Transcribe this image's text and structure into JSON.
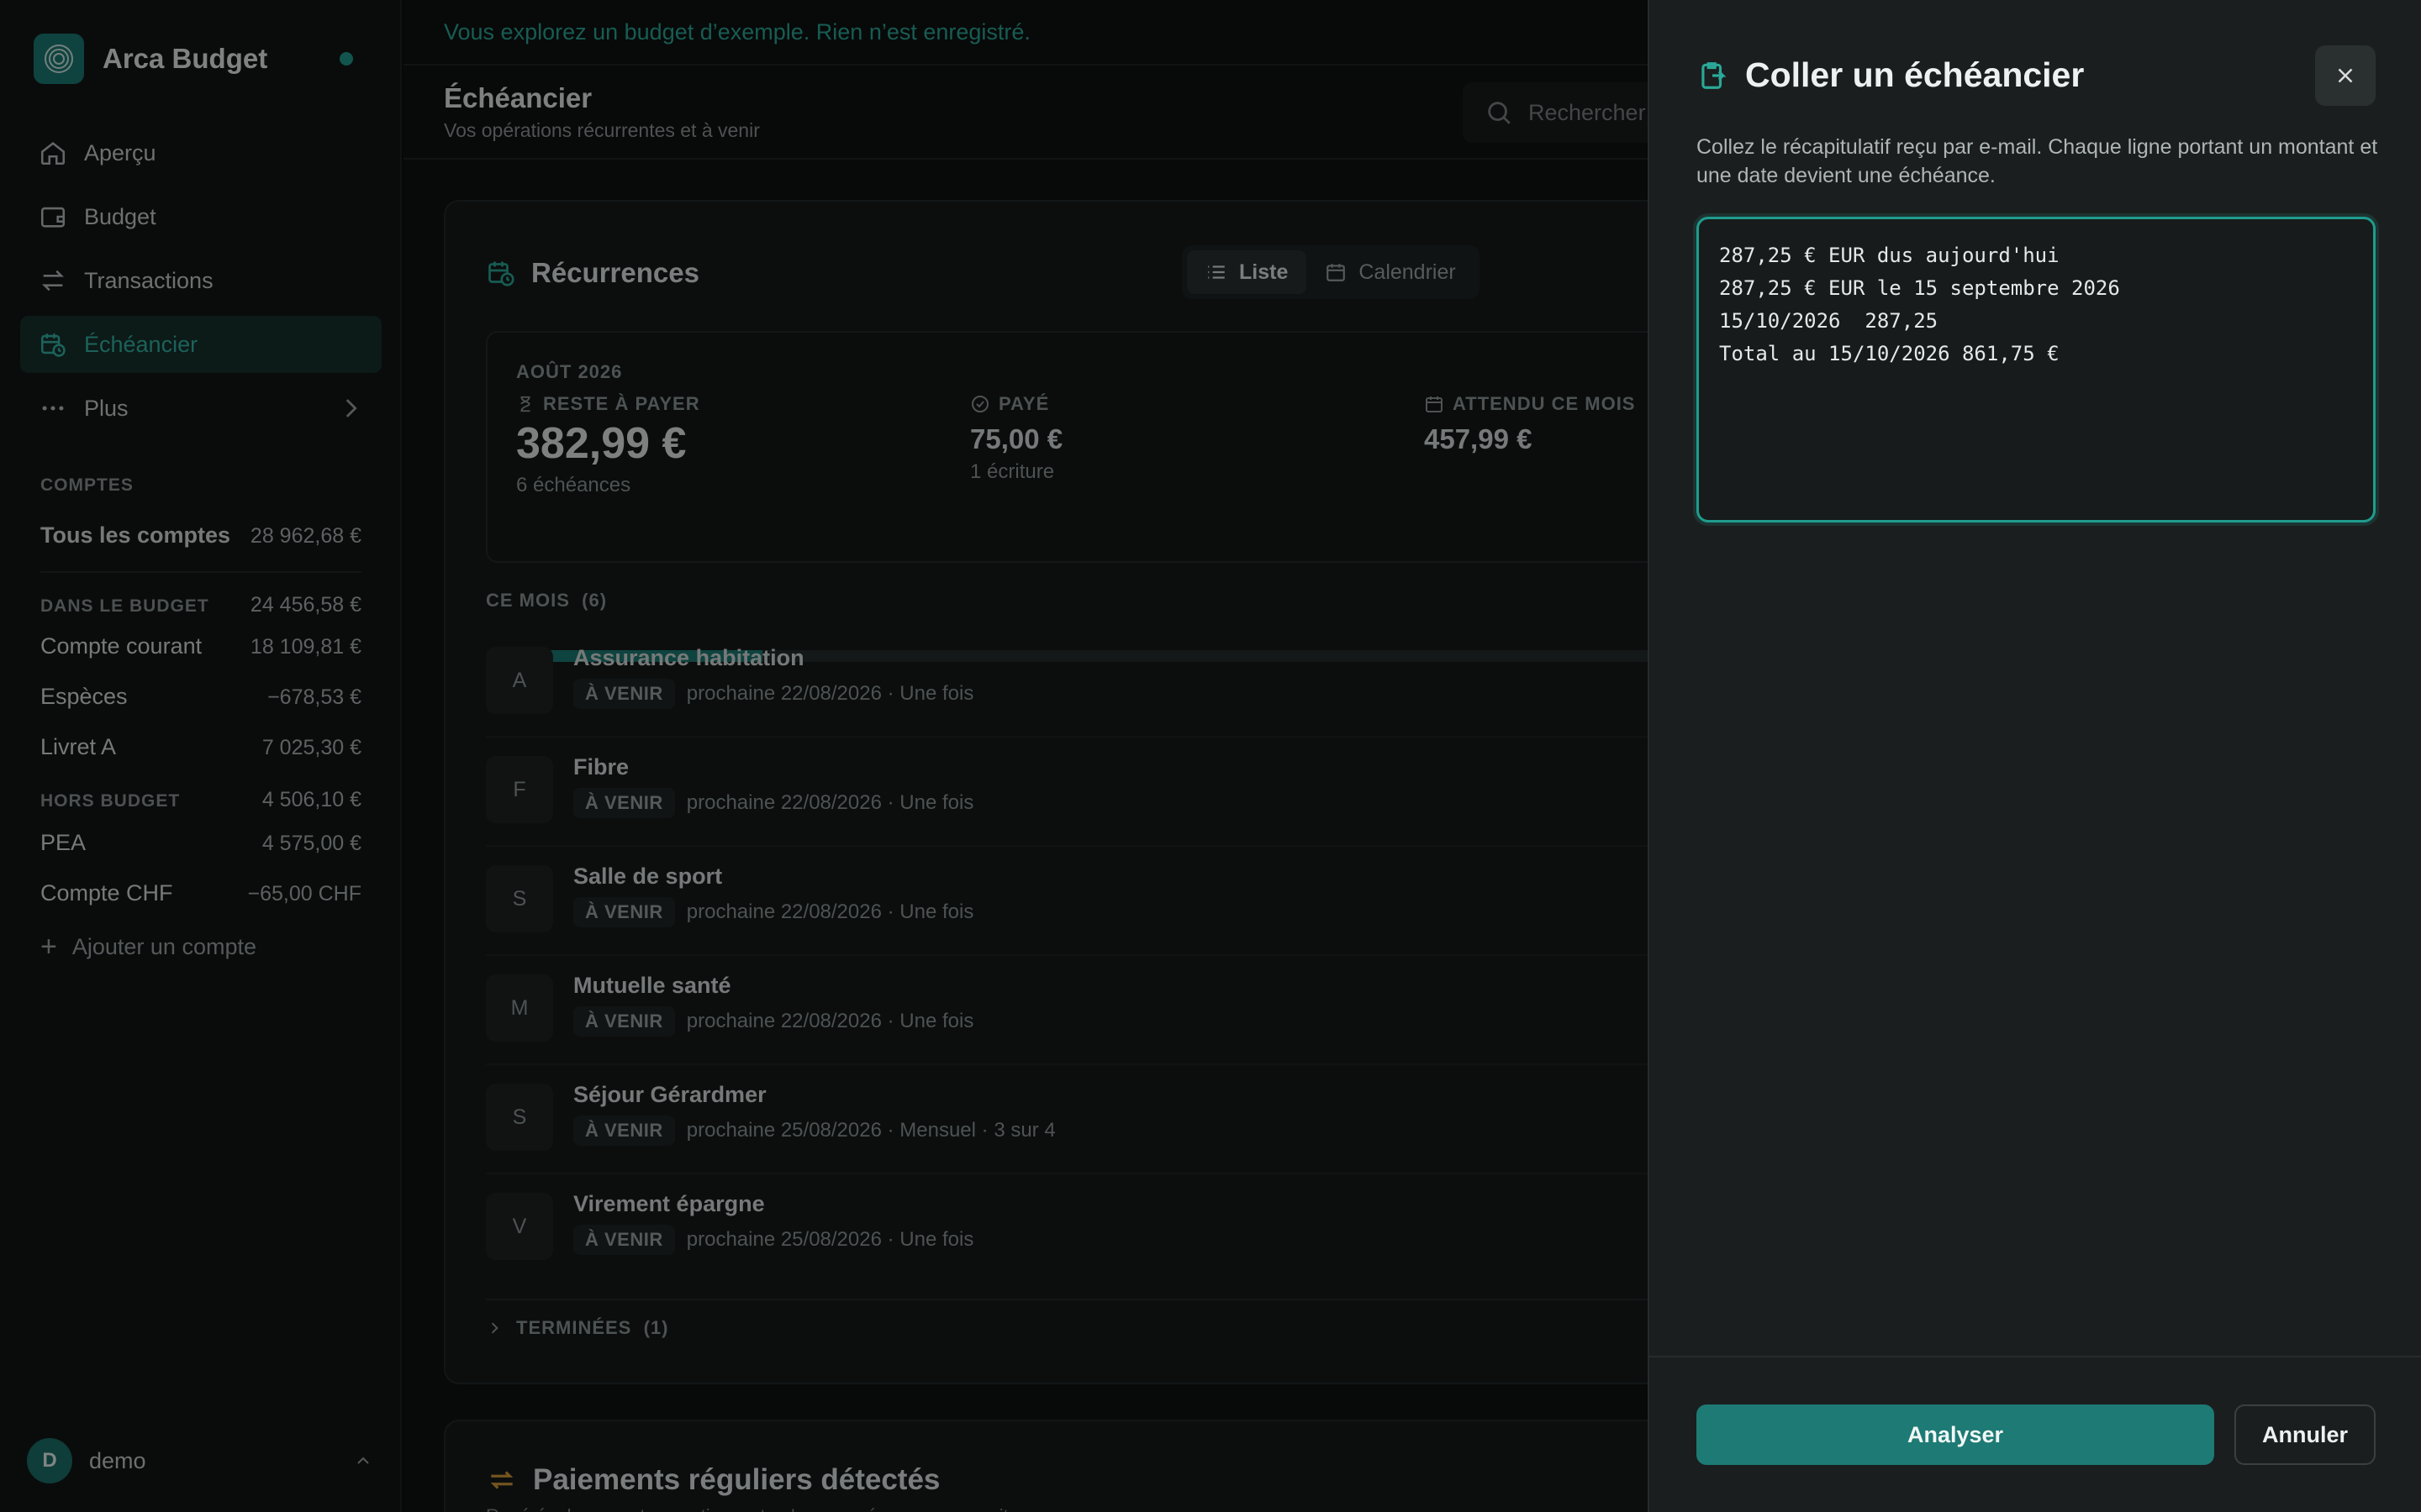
{
  "app": {
    "name": "Arca Budget"
  },
  "sidebar": {
    "nav": [
      {
        "label": "Aperçu",
        "icon": "home-icon"
      },
      {
        "label": "Budget",
        "icon": "wallet-icon"
      },
      {
        "label": "Transactions",
        "icon": "swap-icon"
      },
      {
        "label": "Échéancier",
        "icon": "calendar-clock-icon",
        "active": true
      },
      {
        "label": "Plus",
        "icon": "more-icon"
      }
    ],
    "accounts_title": "COMPTES",
    "all_accounts": {
      "name": "Tous les comptes",
      "value": "28 962,68 €"
    },
    "in_budget": {
      "label": "DANS LE BUDGET",
      "value": "24 456,58 €"
    },
    "budget_accounts": [
      {
        "name": "Compte courant",
        "value": "18 109,81 €"
      },
      {
        "name": "Espèces",
        "value": "−678,53 €"
      },
      {
        "name": "Livret A",
        "value": "7 025,30 €"
      }
    ],
    "off_budget": {
      "label": "HORS BUDGET",
      "value": "4 506,10 €"
    },
    "off_accounts": [
      {
        "name": "PEA",
        "value": "4 575,00 €"
      },
      {
        "name": "Compte CHF",
        "value": "−65,00 CHF"
      }
    ],
    "add_account": "Ajouter un compte",
    "user": {
      "initial": "D",
      "name": "demo"
    }
  },
  "banner": "Vous explorez un budget d’exemple. Rien n’est enregistré.",
  "page": {
    "title": "Échéancier",
    "subtitle": "Vos opérations récurrentes et à venir",
    "search_placeholder": "Rechercher"
  },
  "recurrences": {
    "title": "Récurrences",
    "view_list": "Liste",
    "view_calendar": "Calendrier",
    "month": "AOÛT 2026",
    "remaining": {
      "label": "RESTE À PAYER",
      "value": "382,99 €",
      "sub": "6 échéances"
    },
    "paid": {
      "label": "PAYÉ",
      "value": "75,00 €",
      "sub": "1 écriture"
    },
    "expected": {
      "label": "ATTENDU CE MOIS",
      "value": "457,99 €"
    },
    "progress_paid_fraction": 0.164,
    "this_month_label": "CE MOIS",
    "this_month_count": "(6)",
    "items": [
      {
        "initial": "A",
        "name": "Assurance habitation",
        "status": "À VENIR",
        "detail": "prochaine 22/08/2026 · Une fois"
      },
      {
        "initial": "F",
        "name": "Fibre",
        "status": "À VENIR",
        "detail": "prochaine 22/08/2026 · Une fois"
      },
      {
        "initial": "S",
        "name": "Salle de sport",
        "status": "À VENIR",
        "detail": "prochaine 22/08/2026 · Une fois"
      },
      {
        "initial": "M",
        "name": "Mutuelle santé",
        "status": "À VENIR",
        "detail": "prochaine 22/08/2026 · Une fois"
      },
      {
        "initial": "S",
        "name": "Séjour Gérardmer",
        "status": "À VENIR",
        "detail": "prochaine 25/08/2026 · Mensuel · 3 sur 4"
      },
      {
        "initial": "V",
        "name": "Virement épargne",
        "status": "À VENIR",
        "detail": "prochaine 25/08/2026 · Une fois"
      }
    ],
    "finished_label": "TERMINÉES",
    "finished_count": "(1)"
  },
  "detected": {
    "title": "Paiements réguliers détectés",
    "subtitle": "Repérés dans vos transactions, et qu'aucune récurrence ne suit encore."
  },
  "panel": {
    "title": "Coller un échéancier",
    "description": "Collez le récapitulatif reçu par e-mail. Chaque ligne portant un montant et une date devient une échéance.",
    "text_lines": [
      "287,25 € EUR dus aujourd'hui",
      "287,25 € EUR le 15 septembre 2026",
      "15/10/2026  287,25",
      "Total au 15/10/2026 861,75 €"
    ],
    "analyze": "Analyser",
    "cancel": "Annuler"
  },
  "colors": {
    "accent": "#1d7a74",
    "accent_text": "#33b3a4",
    "background": "#0f1212",
    "panel": "#1b1e1e"
  }
}
